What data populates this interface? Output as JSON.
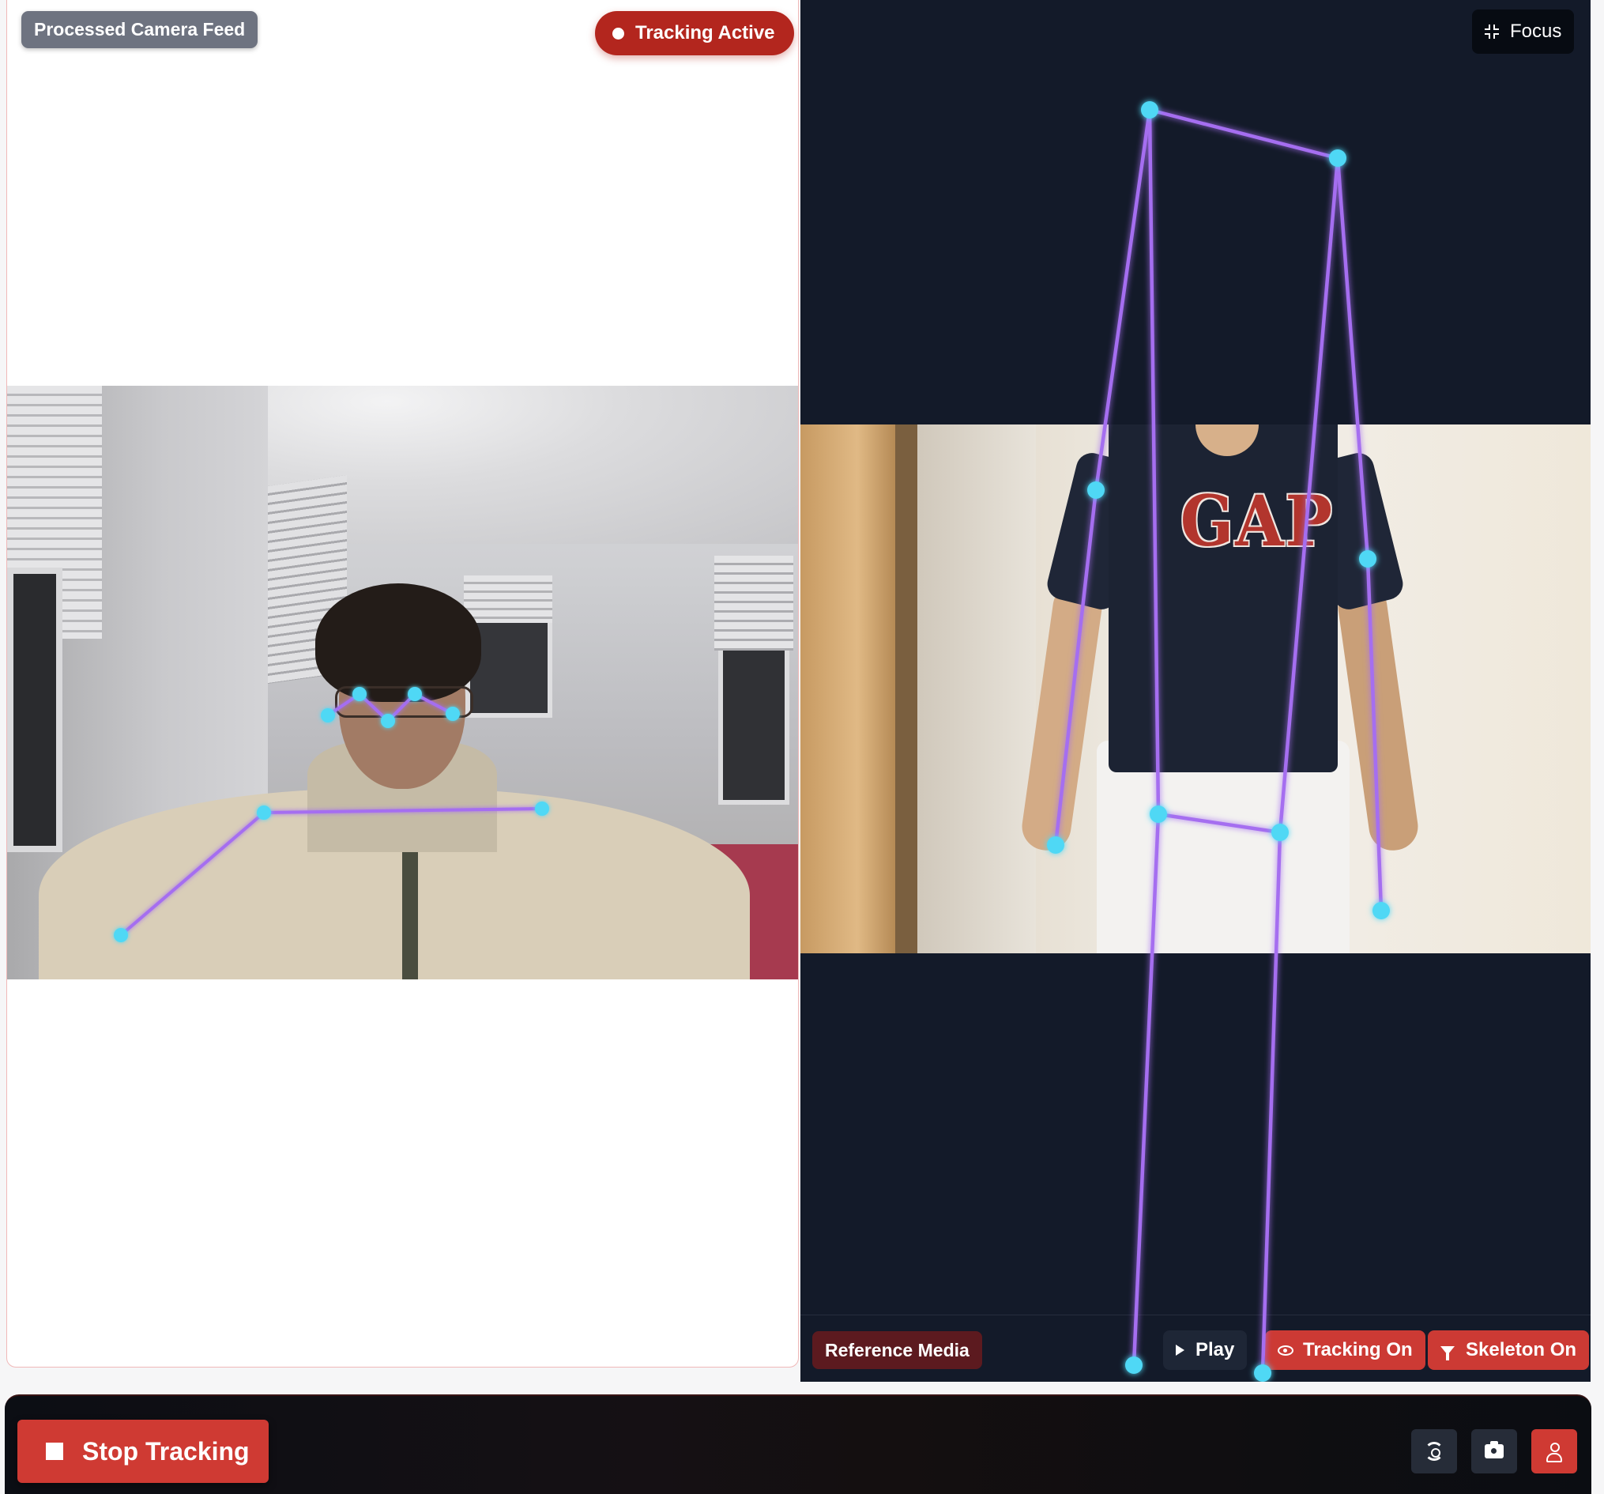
{
  "left_panel": {
    "feed_label": "Processed Camera Feed",
    "tracking_badge": "Tracking Active"
  },
  "right_panel": {
    "focus_label": "Focus",
    "reference_label": "Reference Media",
    "play_label": "Play",
    "tracking_toggle_label": "Tracking On",
    "skeleton_toggle_label": "Skeleton On",
    "shirt_print": "GAP"
  },
  "bottom_bar": {
    "stop_label": "Stop Tracking",
    "icons": [
      "switch-camera-icon",
      "camera-icon",
      "person-icon"
    ]
  },
  "colors": {
    "accent_red": "#cf3a33",
    "badge_red": "#b3261e",
    "skeleton_line": "#a56ef0",
    "skeleton_joint": "#4fd8f5",
    "panel_dark": "#131a29"
  }
}
